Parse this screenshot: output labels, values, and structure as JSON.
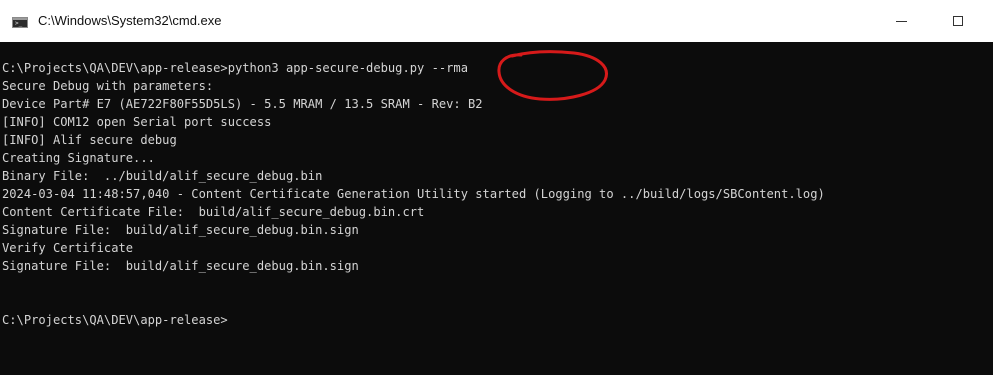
{
  "window": {
    "title": "C:\\Windows\\System32\\cmd.exe",
    "icon": "cmd-icon",
    "controls": {
      "minimize_icon": "minimize-icon",
      "maximize_icon": "maximize-icon"
    }
  },
  "console": {
    "lines": [
      "C:\\Projects\\QA\\DEV\\app-release>python3 app-secure-debug.py --rma",
      "Secure Debug with parameters:",
      "Device Part# E7 (AE722F80F55D5LS) - 5.5 MRAM / 13.5 SRAM - Rev: B2",
      "[INFO] COM12 open Serial port success",
      "[INFO] Alif secure debug",
      "Creating Signature...",
      "Binary File:  ../build/alif_secure_debug.bin",
      "2024-03-04 11:48:57,040 - Content Certificate Generation Utility started (Logging to ../build/logs/SBContent.log)",
      "Content Certificate File:  build/alif_secure_debug.bin.crt",
      "Signature File:  build/alif_secure_debug.bin.sign",
      "Verify Certificate",
      "Signature File:  build/alif_secure_debug.bin.sign",
      "",
      "",
      "C:\\Projects\\QA\\DEV\\app-release>"
    ]
  },
  "colors": {
    "console_background": "#0c0c0c",
    "console_text": "#d4d4d4",
    "annotation_circle": "#d61a1a",
    "titlebar_background": "#ffffff"
  }
}
